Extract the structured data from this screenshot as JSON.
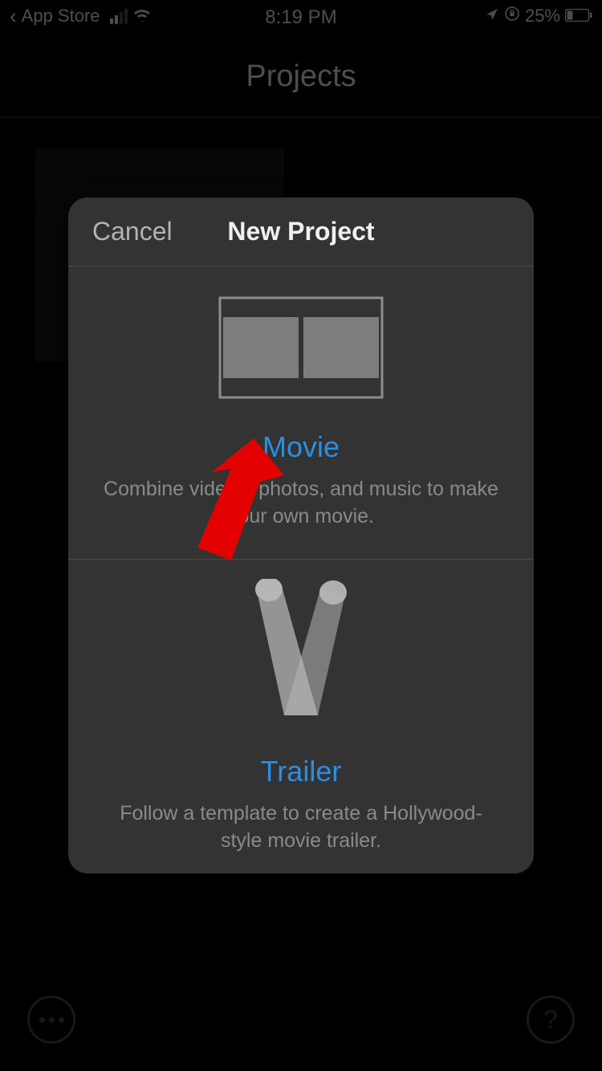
{
  "status_bar": {
    "back_label": "App Store",
    "time": "8:19 PM",
    "battery_text": "25%"
  },
  "page": {
    "title": "Projects"
  },
  "sheet": {
    "cancel_label": "Cancel",
    "title": "New Project",
    "options": [
      {
        "title": "Movie",
        "desc": "Combine videos, photos, and music to make your own movie."
      },
      {
        "title": "Trailer",
        "desc": "Follow a template to create a Hollywood-style movie trailer."
      }
    ]
  },
  "colors": {
    "accent": "#2a8fe4",
    "sheet_bg": "#333333",
    "muted_text": "#8a8a8a"
  }
}
